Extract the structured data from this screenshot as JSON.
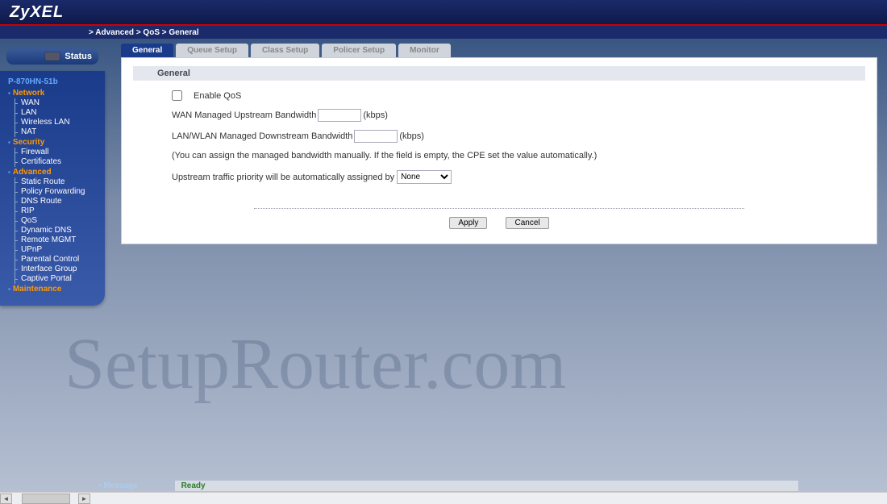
{
  "brand": "ZyXEL",
  "breadcrumb": "> Advanced > QoS > General",
  "model": "P-870HN-51b",
  "status_label": "Status",
  "nav": {
    "sections": [
      {
        "label": "Network",
        "items": [
          "WAN",
          "LAN",
          "Wireless LAN",
          "NAT"
        ]
      },
      {
        "label": "Security",
        "items": [
          "Firewall",
          "Certificates"
        ]
      },
      {
        "label": "Advanced",
        "items": [
          "Static Route",
          "Policy Forwarding",
          "DNS Route",
          "RIP",
          "QoS",
          "Dynamic DNS",
          "Remote MGMT",
          "UPnP",
          "Parental Control",
          "Interface Group",
          "Captive Portal"
        ]
      },
      {
        "label": "Maintenance",
        "items": []
      }
    ]
  },
  "tabs": [
    "General",
    "Queue Setup",
    "Class Setup",
    "Policer Setup",
    "Monitor"
  ],
  "active_tab": 0,
  "panel_title": "General",
  "form": {
    "enable_label": "Enable QoS",
    "wan_up_label": "WAN Managed Upstream Bandwidth",
    "wan_up_unit": "(kbps)",
    "lan_down_label": "LAN/WLAN Managed Downstream Bandwidth",
    "lan_down_unit": "(kbps)",
    "note": "(You can assign the managed bandwidth manually. If the field is empty, the CPE set the value automatically.)",
    "priority_label": "Upstream traffic priority will be automatically assigned by",
    "priority_value": "None"
  },
  "buttons": {
    "apply": "Apply",
    "cancel": "Cancel"
  },
  "footer": {
    "message_label": "Message",
    "status": "Ready"
  },
  "watermark": "SetupRouter.com"
}
